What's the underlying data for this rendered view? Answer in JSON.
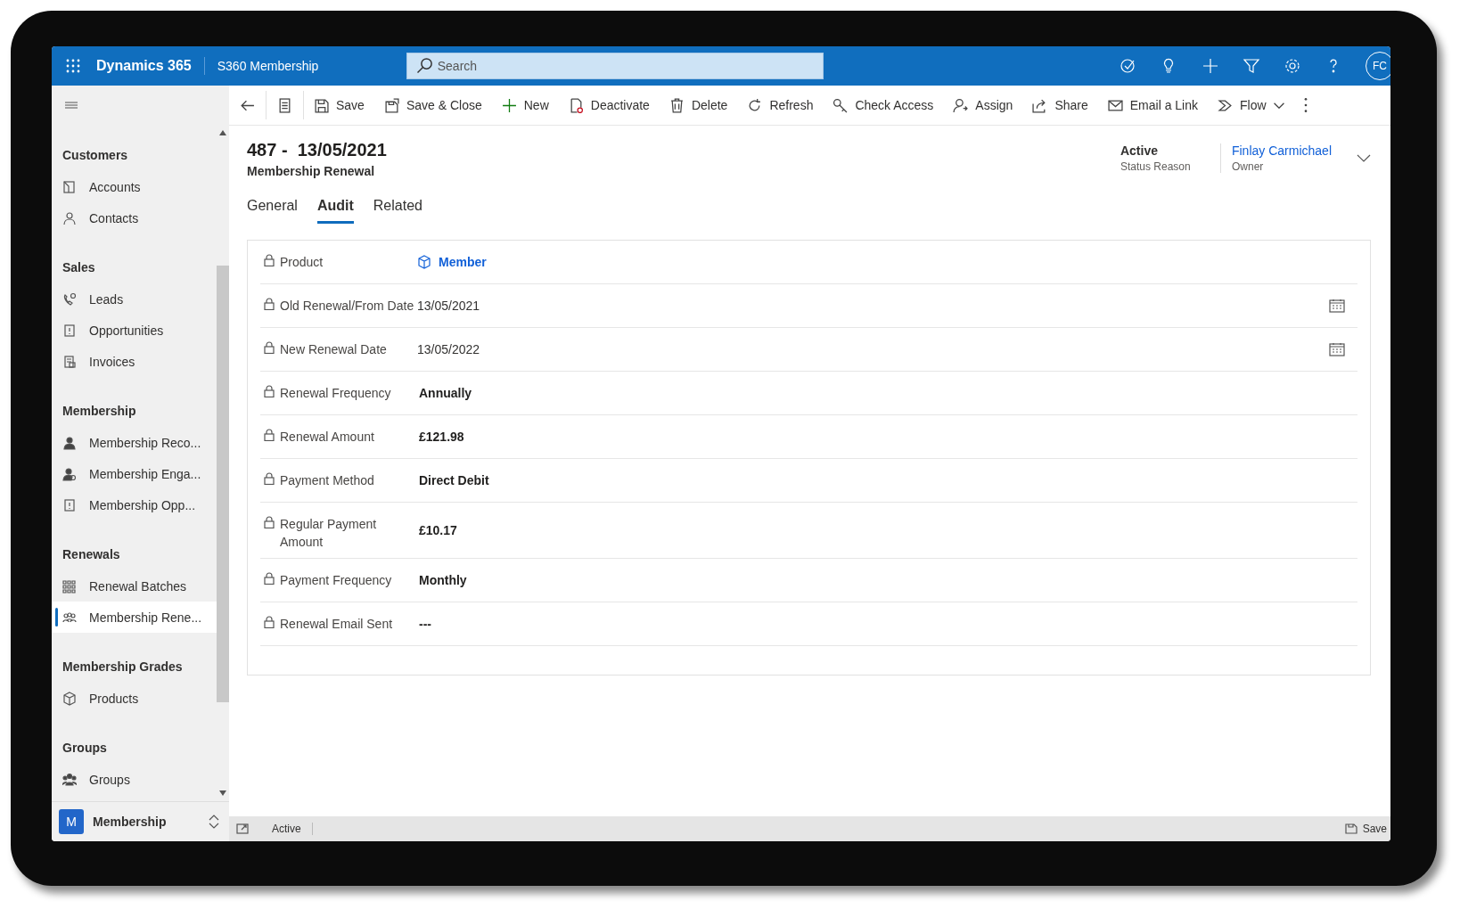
{
  "topbar": {
    "app_name": "Dynamics 365",
    "area": "S360 Membership",
    "search": {
      "placeholder": "Search"
    },
    "avatar": "FC"
  },
  "commands": [
    {
      "kind": "icon"
    },
    {
      "kind": "icon"
    },
    {
      "kind": "button",
      "label": "Save"
    },
    {
      "kind": "button",
      "label": "Save & Close"
    },
    {
      "kind": "button",
      "label": "New"
    },
    {
      "kind": "button",
      "label": "Deactivate"
    },
    {
      "kind": "button",
      "label": "Delete"
    },
    {
      "kind": "button",
      "label": "Refresh"
    },
    {
      "kind": "button",
      "label": "Check Access"
    },
    {
      "kind": "button",
      "label": "Assign"
    },
    {
      "kind": "button",
      "label": "Share"
    },
    {
      "kind": "button",
      "label": "Email a Link"
    },
    {
      "kind": "dropdown",
      "label": "Flow"
    },
    {
      "kind": "more"
    }
  ],
  "sidebar": {
    "groups": [
      {
        "title": "Customers",
        "items": [
          {
            "label": "Accounts",
            "selected": false
          },
          {
            "label": "Contacts",
            "selected": false
          }
        ]
      },
      {
        "title": "Sales",
        "items": [
          {
            "label": "Leads",
            "selected": false
          },
          {
            "label": "Opportunities",
            "selected": false
          },
          {
            "label": "Invoices",
            "selected": false
          }
        ]
      },
      {
        "title": "Membership",
        "items": [
          {
            "label": "Membership Reco...",
            "selected": false
          },
          {
            "label": "Membership Enga...",
            "selected": false
          },
          {
            "label": "Membership Opp...",
            "selected": false
          }
        ]
      },
      {
        "title": "Renewals",
        "items": [
          {
            "label": "Renewal Batches",
            "selected": false
          },
          {
            "label": "Membership Rene...",
            "selected": true
          }
        ]
      },
      {
        "title": "Membership Grades",
        "items": [
          {
            "label": "Products",
            "selected": false
          }
        ]
      },
      {
        "title": "Groups",
        "items": [
          {
            "label": "Groups",
            "selected": false
          }
        ]
      }
    ],
    "area_switcher": {
      "badge": "M",
      "label": "Membership"
    }
  },
  "record": {
    "title": "487 -  13/05/2021",
    "entity": "Membership Renewal",
    "header_fields": [
      {
        "value": "Active",
        "label": "Status Reason",
        "kind": "text"
      },
      {
        "value": "Finlay Carmichael",
        "label": "Owner",
        "kind": "link"
      }
    ],
    "tabs": [
      {
        "label": "General",
        "selected": false
      },
      {
        "label": "Audit",
        "selected": true
      },
      {
        "label": "Related",
        "selected": false
      }
    ],
    "fields": [
      {
        "label": "Product",
        "value": "Member",
        "kind": "lookup"
      },
      {
        "label": "Old Renewal/From Date",
        "value": "13/05/2021",
        "kind": "date"
      },
      {
        "label": "New Renewal Date",
        "value": "13/05/2022",
        "kind": "date"
      },
      {
        "label": "Renewal Frequency",
        "value": "Annually",
        "kind": "text"
      },
      {
        "label": "Renewal Amount",
        "value": "£121.98",
        "kind": "text"
      },
      {
        "label": "Payment Method",
        "value": "Direct Debit",
        "kind": "text"
      },
      {
        "label": "Regular Payment Amount",
        "value": "£10.17",
        "kind": "text"
      },
      {
        "label": "Payment Frequency",
        "value": "Monthly",
        "kind": "text"
      },
      {
        "label": "Renewal Email Sent",
        "value": "---",
        "kind": "text"
      }
    ]
  },
  "status_bar": {
    "status": "Active",
    "save": "Save"
  }
}
